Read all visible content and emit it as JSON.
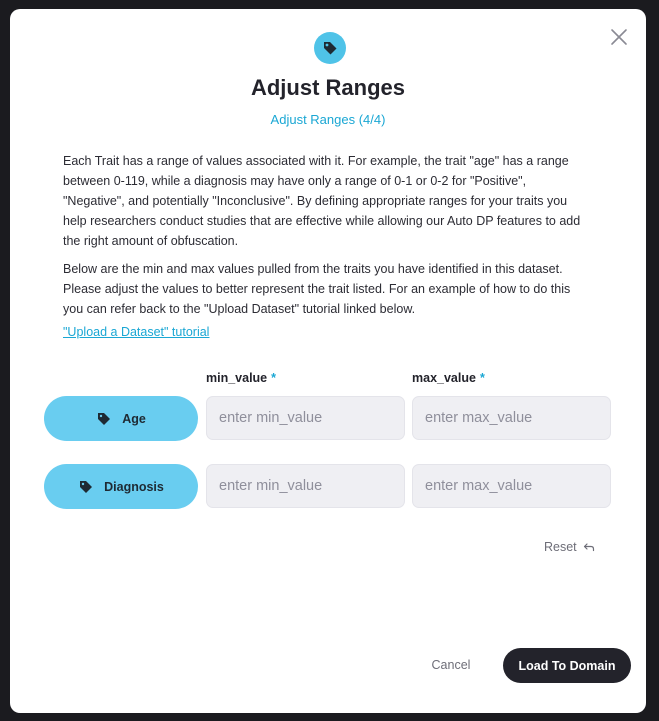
{
  "dialog": {
    "title": "Adjust Ranges",
    "subtitle": "Adjust Ranges (4/4)",
    "paragraph_1": "Each Trait has a range of values associated with it. For example, the trait \"age\" has a range between 0-119, while a diagnosis may have only a range of 0-1 or 0-2 for \"Positive\", \"Negative\", and potentially \"Inconclusive\". By defining appropriate ranges for your traits you help researchers conduct studies that are effective while allowing our Auto DP features to add the right amount of obfuscation.",
    "paragraph_2": "Below are the min and max values pulled from the traits you have identified in this dataset. Please adjust the values to better represent the trait listed. For an example of how to do this you can refer back to the \"Upload Dataset\" tutorial linked below.",
    "tutorial_link": "\"Upload a Dataset\" tutorial",
    "header_icon": "tag-icon",
    "close_icon": "close-icon"
  },
  "columns": {
    "min_label": "min_value",
    "max_label": "max_value",
    "required_marker": "*"
  },
  "traits": [
    {
      "label": "Age",
      "icon": "tag-icon",
      "min_placeholder": "enter min_value",
      "max_placeholder": "enter max_value",
      "min_value": "",
      "max_value": ""
    },
    {
      "label": "Diagnosis",
      "icon": "tag-icon",
      "min_placeholder": "enter min_value",
      "max_placeholder": "enter max_value",
      "min_value": "",
      "max_value": ""
    }
  ],
  "actions": {
    "reset_label": "Reset",
    "reset_icon": "undo-icon",
    "cancel_label": "Cancel",
    "load_label": "Load To Domain"
  },
  "colors": {
    "accent": "#1aa7d4",
    "pill": "#69cdf0",
    "primary_button": "#23232b",
    "backdrop": "#1b1b1f"
  }
}
